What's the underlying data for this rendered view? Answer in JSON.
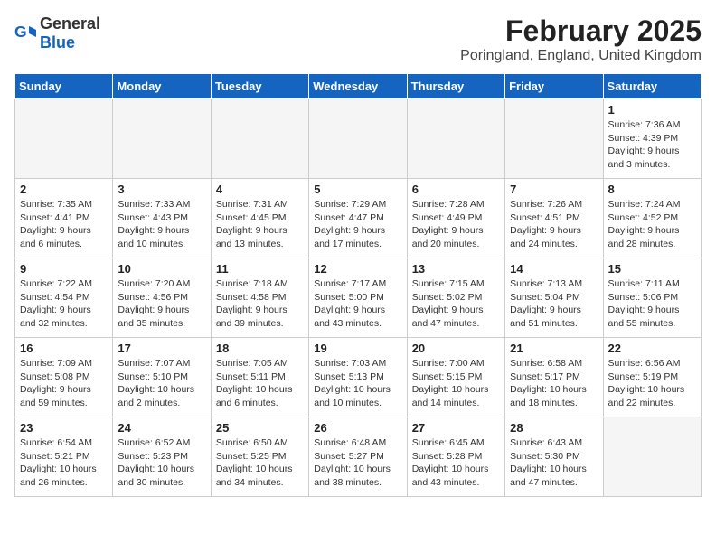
{
  "logo": {
    "general": "General",
    "blue": "Blue"
  },
  "title": "February 2025",
  "subtitle": "Poringland, England, United Kingdom",
  "days_of_week": [
    "Sunday",
    "Monday",
    "Tuesday",
    "Wednesday",
    "Thursday",
    "Friday",
    "Saturday"
  ],
  "weeks": [
    [
      {
        "day": "",
        "info": ""
      },
      {
        "day": "",
        "info": ""
      },
      {
        "day": "",
        "info": ""
      },
      {
        "day": "",
        "info": ""
      },
      {
        "day": "",
        "info": ""
      },
      {
        "day": "",
        "info": ""
      },
      {
        "day": "1",
        "info": "Sunrise: 7:36 AM\nSunset: 4:39 PM\nDaylight: 9 hours and 3 minutes."
      }
    ],
    [
      {
        "day": "2",
        "info": "Sunrise: 7:35 AM\nSunset: 4:41 PM\nDaylight: 9 hours and 6 minutes."
      },
      {
        "day": "3",
        "info": "Sunrise: 7:33 AM\nSunset: 4:43 PM\nDaylight: 9 hours and 10 minutes."
      },
      {
        "day": "4",
        "info": "Sunrise: 7:31 AM\nSunset: 4:45 PM\nDaylight: 9 hours and 13 minutes."
      },
      {
        "day": "5",
        "info": "Sunrise: 7:29 AM\nSunset: 4:47 PM\nDaylight: 9 hours and 17 minutes."
      },
      {
        "day": "6",
        "info": "Sunrise: 7:28 AM\nSunset: 4:49 PM\nDaylight: 9 hours and 20 minutes."
      },
      {
        "day": "7",
        "info": "Sunrise: 7:26 AM\nSunset: 4:51 PM\nDaylight: 9 hours and 24 minutes."
      },
      {
        "day": "8",
        "info": "Sunrise: 7:24 AM\nSunset: 4:52 PM\nDaylight: 9 hours and 28 minutes."
      }
    ],
    [
      {
        "day": "9",
        "info": "Sunrise: 7:22 AM\nSunset: 4:54 PM\nDaylight: 9 hours and 32 minutes."
      },
      {
        "day": "10",
        "info": "Sunrise: 7:20 AM\nSunset: 4:56 PM\nDaylight: 9 hours and 35 minutes."
      },
      {
        "day": "11",
        "info": "Sunrise: 7:18 AM\nSunset: 4:58 PM\nDaylight: 9 hours and 39 minutes."
      },
      {
        "day": "12",
        "info": "Sunrise: 7:17 AM\nSunset: 5:00 PM\nDaylight: 9 hours and 43 minutes."
      },
      {
        "day": "13",
        "info": "Sunrise: 7:15 AM\nSunset: 5:02 PM\nDaylight: 9 hours and 47 minutes."
      },
      {
        "day": "14",
        "info": "Sunrise: 7:13 AM\nSunset: 5:04 PM\nDaylight: 9 hours and 51 minutes."
      },
      {
        "day": "15",
        "info": "Sunrise: 7:11 AM\nSunset: 5:06 PM\nDaylight: 9 hours and 55 minutes."
      }
    ],
    [
      {
        "day": "16",
        "info": "Sunrise: 7:09 AM\nSunset: 5:08 PM\nDaylight: 9 hours and 59 minutes."
      },
      {
        "day": "17",
        "info": "Sunrise: 7:07 AM\nSunset: 5:10 PM\nDaylight: 10 hours and 2 minutes."
      },
      {
        "day": "18",
        "info": "Sunrise: 7:05 AM\nSunset: 5:11 PM\nDaylight: 10 hours and 6 minutes."
      },
      {
        "day": "19",
        "info": "Sunrise: 7:03 AM\nSunset: 5:13 PM\nDaylight: 10 hours and 10 minutes."
      },
      {
        "day": "20",
        "info": "Sunrise: 7:00 AM\nSunset: 5:15 PM\nDaylight: 10 hours and 14 minutes."
      },
      {
        "day": "21",
        "info": "Sunrise: 6:58 AM\nSunset: 5:17 PM\nDaylight: 10 hours and 18 minutes."
      },
      {
        "day": "22",
        "info": "Sunrise: 6:56 AM\nSunset: 5:19 PM\nDaylight: 10 hours and 22 minutes."
      }
    ],
    [
      {
        "day": "23",
        "info": "Sunrise: 6:54 AM\nSunset: 5:21 PM\nDaylight: 10 hours and 26 minutes."
      },
      {
        "day": "24",
        "info": "Sunrise: 6:52 AM\nSunset: 5:23 PM\nDaylight: 10 hours and 30 minutes."
      },
      {
        "day": "25",
        "info": "Sunrise: 6:50 AM\nSunset: 5:25 PM\nDaylight: 10 hours and 34 minutes."
      },
      {
        "day": "26",
        "info": "Sunrise: 6:48 AM\nSunset: 5:27 PM\nDaylight: 10 hours and 38 minutes."
      },
      {
        "day": "27",
        "info": "Sunrise: 6:45 AM\nSunset: 5:28 PM\nDaylight: 10 hours and 43 minutes."
      },
      {
        "day": "28",
        "info": "Sunrise: 6:43 AM\nSunset: 5:30 PM\nDaylight: 10 hours and 47 minutes."
      },
      {
        "day": "",
        "info": ""
      }
    ]
  ]
}
